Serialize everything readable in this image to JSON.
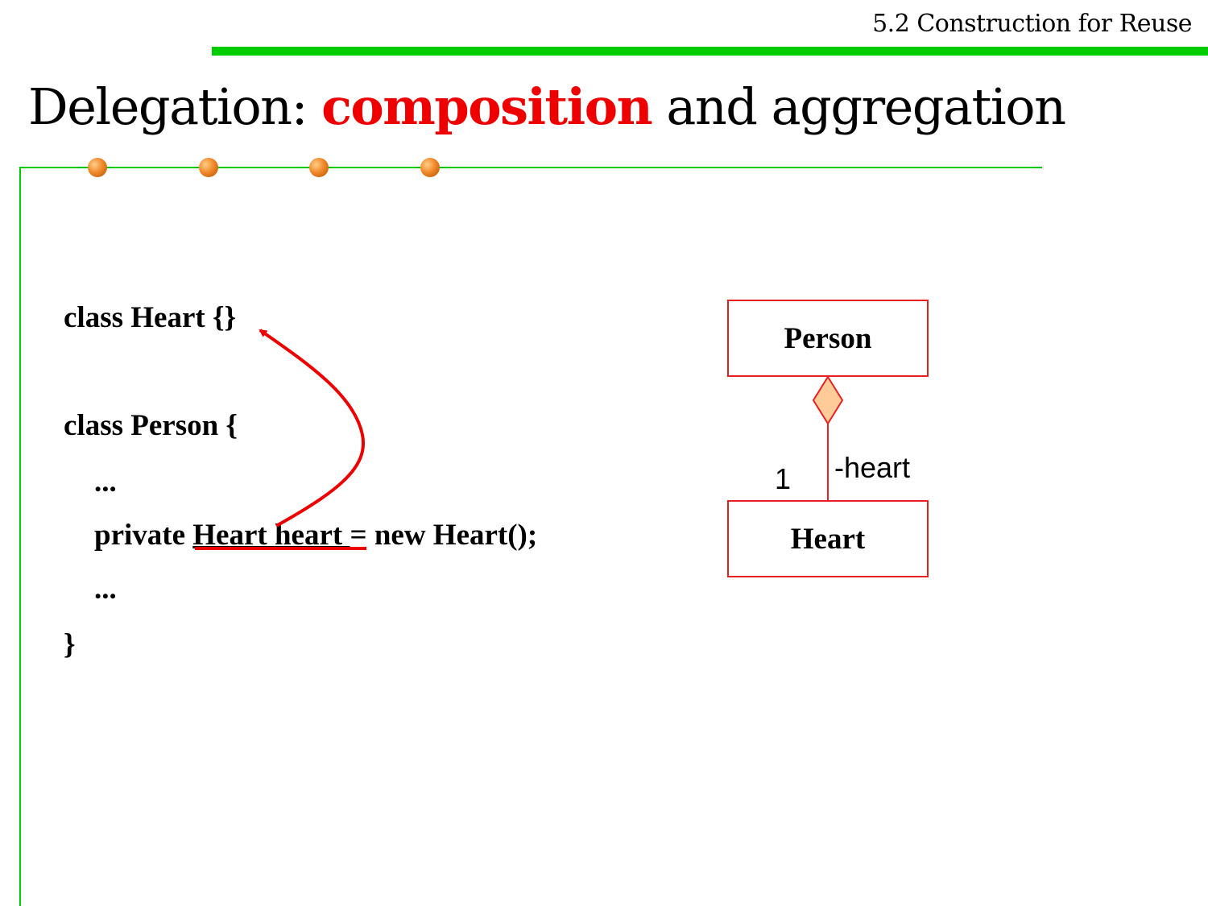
{
  "header": {
    "section": "5.2 Construction for Reuse"
  },
  "title": {
    "prefix": "Delegation: ",
    "highlight": "composition",
    "suffix": " and aggregation"
  },
  "code": {
    "line1": "class Heart {}",
    "line2": "class Person {",
    "line3": "...",
    "line4_pre": "private ",
    "line4_underlined": "Heart heart ",
    "line4_post": "= new Heart();",
    "line5": "...",
    "line6": "}"
  },
  "uml": {
    "whole_class": "Person",
    "part_class": "Heart",
    "role": "-heart",
    "multiplicity": "1",
    "relation": "aggregation"
  },
  "colors": {
    "accent_green": "#00cc00",
    "highlight_red": "#ee0000",
    "uml_border": "#e8201f",
    "diamond_fill": "#ffcc99",
    "bullet_orange": "#f0892a"
  }
}
